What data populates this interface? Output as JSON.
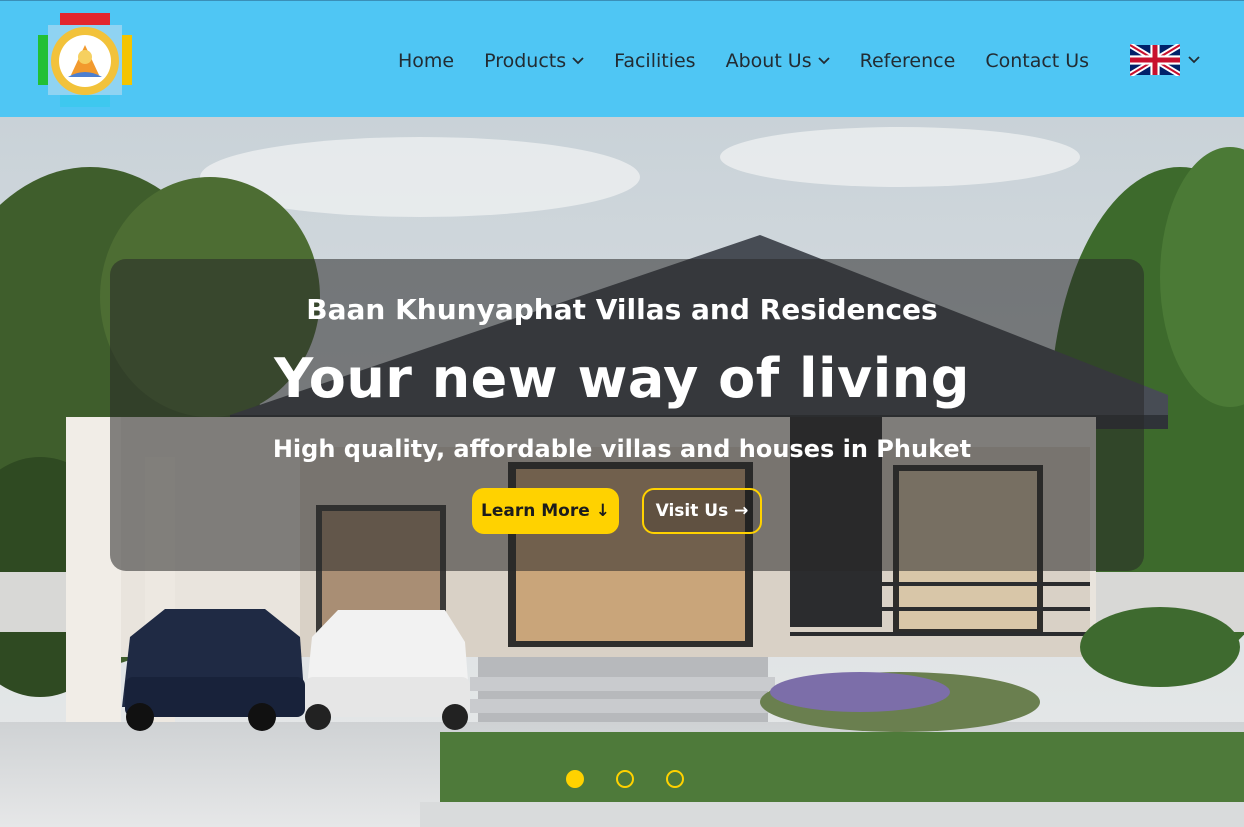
{
  "nav": {
    "items": [
      {
        "label": "Home",
        "dropdown": false
      },
      {
        "label": "Products",
        "dropdown": true
      },
      {
        "label": "Facilities",
        "dropdown": false
      },
      {
        "label": "About Us",
        "dropdown": true
      },
      {
        "label": "Reference",
        "dropdown": false
      },
      {
        "label": "Contact Us",
        "dropdown": false
      }
    ],
    "language_icon": "uk-flag-icon",
    "background": "#4fc6f4"
  },
  "hero": {
    "subtitle": "Baan Khunyaphat Villas and Residences",
    "headline": "Your new way of living",
    "tagline": "High quality, affordable villas and houses in Phuket",
    "learn_more": "Learn More ↓",
    "visit_us": "Visit Us →",
    "accent": "#ffd200",
    "slides": {
      "count": 3,
      "active": 1
    }
  }
}
